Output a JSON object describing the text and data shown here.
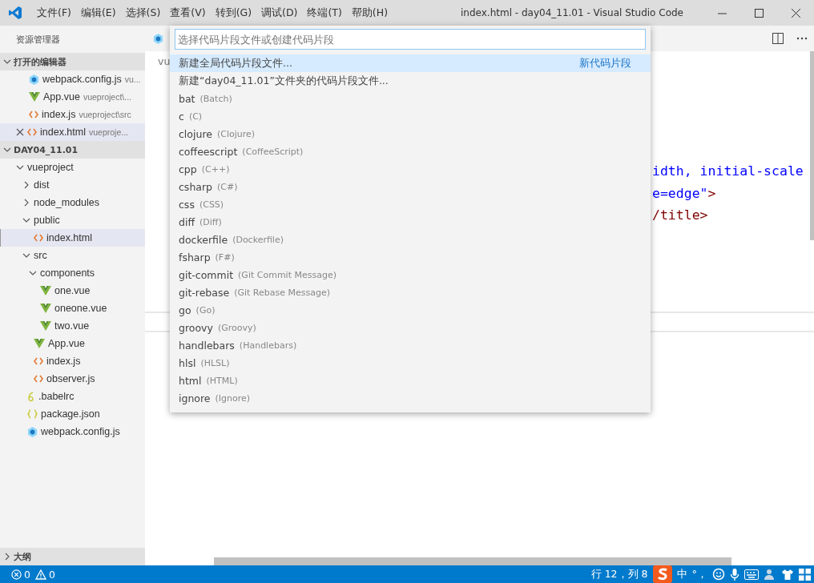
{
  "window": {
    "title": "index.html - day04_11.01 - Visual Studio Code"
  },
  "menu": [
    "文件(F)",
    "编辑(E)",
    "选择(S)",
    "查看(V)",
    "转到(G)",
    "调试(D)",
    "终端(T)",
    "帮助(H)"
  ],
  "sidebar": {
    "title": "资源管理器",
    "open_editors": {
      "label": "打开的编辑器",
      "expanded": true,
      "items": [
        {
          "kind": "webpack",
          "name": "webpack.config.js",
          "path": "vu...",
          "selected": false
        },
        {
          "kind": "vue",
          "name": "App.vue",
          "path": "vueproject\\...",
          "selected": false
        },
        {
          "kind": "code",
          "name": "index.js",
          "path": "vueproject\\src",
          "selected": false
        },
        {
          "kind": "code",
          "name": "index.html",
          "path": "vueproje...",
          "selected": true
        }
      ]
    },
    "folder": {
      "label": "DAY04_11.01",
      "expanded": true,
      "items": [
        {
          "kind": "folder",
          "name": "vueproject",
          "expanded": true,
          "selected": false,
          "children": [
            {
              "kind": "folder",
              "name": "dist",
              "expanded": false,
              "selected": false
            },
            {
              "kind": "folder",
              "name": "node_modules",
              "expanded": false,
              "selected": false
            },
            {
              "kind": "folder",
              "name": "public",
              "expanded": true,
              "selected": false,
              "children": [
                {
                  "kind": "code",
                  "name": "index.html",
                  "selected": true
                }
              ]
            },
            {
              "kind": "folder",
              "name": "src",
              "expanded": true,
              "selected": false,
              "children": [
                {
                  "kind": "folder",
                  "name": "components",
                  "expanded": true,
                  "selected": false,
                  "children": [
                    {
                      "kind": "vue",
                      "name": "one.vue",
                      "selected": false
                    },
                    {
                      "kind": "vue",
                      "name": "oneone.vue",
                      "selected": false
                    },
                    {
                      "kind": "vue",
                      "name": "two.vue",
                      "selected": false
                    }
                  ]
                },
                {
                  "kind": "vue",
                  "name": "App.vue",
                  "selected": false
                },
                {
                  "kind": "code",
                  "name": "index.js",
                  "selected": false
                },
                {
                  "kind": "code",
                  "name": "observer.js",
                  "selected": false
                }
              ]
            },
            {
              "kind": "babel",
              "name": ".babelrc",
              "selected": false
            },
            {
              "kind": "json",
              "name": "package.json",
              "selected": false
            },
            {
              "kind": "webpack",
              "name": "webpack.config.js",
              "selected": false
            }
          ]
        }
      ]
    },
    "outline": {
      "label": "大纲",
      "expanded": false
    }
  },
  "editor": {
    "breadcrumb": "vu",
    "code_lines": [
      [
        {
          "kind": "value",
          "text": "idth, initial-scale"
        }
      ],
      [
        {
          "kind": "value",
          "text": "e=edge\""
        },
        {
          "kind": "tag",
          "text": ">"
        }
      ],
      [
        {
          "kind": "tag",
          "text": "/title>"
        }
      ]
    ]
  },
  "quick_pick": {
    "placeholder": "选择代码片段文件或创建代码片段",
    "items": [
      {
        "label": "新建全局代码片段文件...",
        "selected": true,
        "badge": "新代码片段"
      },
      {
        "label": "新建“day04_11.01”文件夹的代码片段文件...",
        "selected": false
      },
      {
        "label": "bat",
        "detail": "(Batch)",
        "selected": false
      },
      {
        "label": "c",
        "detail": "(C)",
        "selected": false
      },
      {
        "label": "clojure",
        "detail": "(Clojure)",
        "selected": false
      },
      {
        "label": "coffeescript",
        "detail": "(CoffeeScript)",
        "selected": false
      },
      {
        "label": "cpp",
        "detail": "(C++)",
        "selected": false
      },
      {
        "label": "csharp",
        "detail": "(C#)",
        "selected": false
      },
      {
        "label": "css",
        "detail": "(CSS)",
        "selected": false
      },
      {
        "label": "diff",
        "detail": "(Diff)",
        "selected": false
      },
      {
        "label": "dockerfile",
        "detail": "(Dockerfile)",
        "selected": false
      },
      {
        "label": "fsharp",
        "detail": "(F#)",
        "selected": false
      },
      {
        "label": "git-commit",
        "detail": "(Git Commit Message)",
        "selected": false
      },
      {
        "label": "git-rebase",
        "detail": "(Git Rebase Message)",
        "selected": false
      },
      {
        "label": "go",
        "detail": "(Go)",
        "selected": false
      },
      {
        "label": "groovy",
        "detail": "(Groovy)",
        "selected": false
      },
      {
        "label": "handlebars",
        "detail": "(Handlebars)",
        "selected": false
      },
      {
        "label": "hlsl",
        "detail": "(HLSL)",
        "selected": false
      },
      {
        "label": "html",
        "detail": "(HTML)",
        "selected": false
      },
      {
        "label": "ignore",
        "detail": "(Ignore)",
        "selected": false
      }
    ]
  },
  "status_bar": {
    "errors": "0",
    "warnings": "0",
    "position": "行 12，列 8",
    "ime_mode": "中",
    "ime_punct": "°，"
  }
}
